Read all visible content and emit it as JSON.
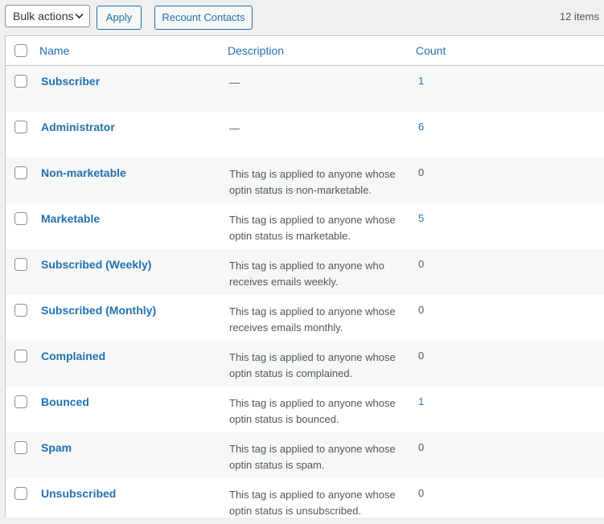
{
  "toolbar": {
    "bulk_actions": "Bulk actions",
    "apply": "Apply",
    "recount": "Recount Contacts",
    "items_count": "12 items"
  },
  "table": {
    "headers": {
      "name": "Name",
      "description": "Description",
      "count": "Count"
    },
    "rows": [
      {
        "name": "Subscriber",
        "description": "—",
        "count": "1",
        "count_link": true
      },
      {
        "name": "Administrator",
        "description": "—",
        "count": "6",
        "count_link": true
      },
      {
        "name": "Non-marketable",
        "description": "This tag is applied to anyone whose optin status is non-marketable.",
        "count": "0",
        "count_link": false
      },
      {
        "name": "Marketable",
        "description": "This tag is applied to anyone whose optin status is marketable.",
        "count": "5",
        "count_link": true
      },
      {
        "name": "Subscribed (Weekly)",
        "description": "This tag is applied to anyone who receives emails weekly.",
        "count": "0",
        "count_link": false
      },
      {
        "name": "Subscribed (Monthly)",
        "description": "This tag is applied to anyone whose receives emails monthly.",
        "count": "0",
        "count_link": false
      },
      {
        "name": "Complained",
        "description": "This tag is applied to anyone whose optin status is complained.",
        "count": "0",
        "count_link": false
      },
      {
        "name": "Bounced",
        "description": "This tag is applied to anyone whose optin status is bounced.",
        "count": "1",
        "count_link": true
      },
      {
        "name": "Spam",
        "description": "This tag is applied to anyone whose optin status is spam.",
        "count": "0",
        "count_link": false
      },
      {
        "name": "Unsubscribed",
        "description": "This tag is applied to anyone whose optin status is unsubscribed.",
        "count": "0",
        "count_link": false
      }
    ]
  },
  "colors": {
    "link": "#2271b1",
    "text": "#50575e",
    "row_alt": "#f6f7f7",
    "background": "#f0f0f1"
  }
}
